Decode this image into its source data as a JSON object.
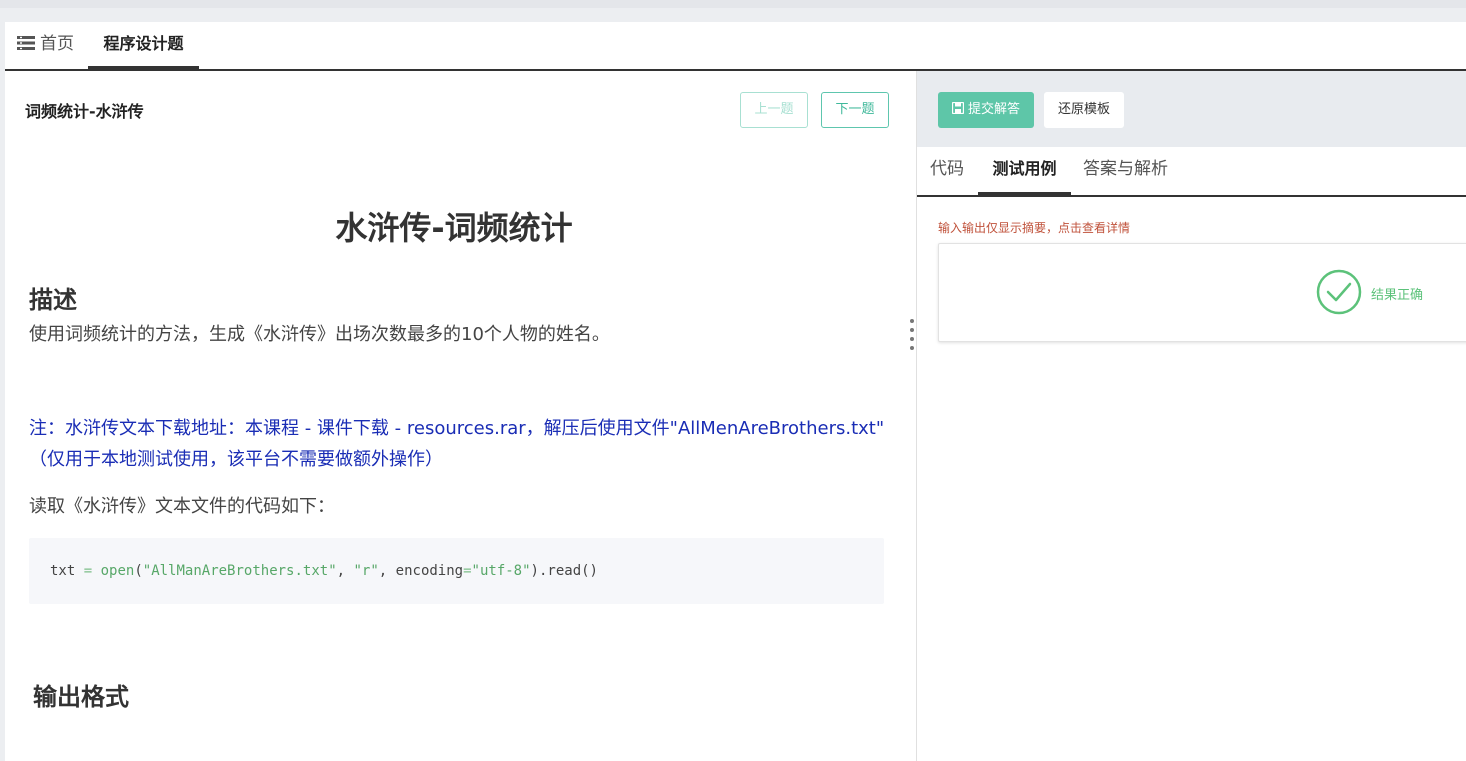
{
  "tabs": {
    "home": "首页",
    "program": "程序设计题"
  },
  "question": {
    "title": "词频统计-水浒传",
    "prev_label": "上一题",
    "next_label": "下一题",
    "heading": "水浒传-词频统计",
    "desc_heading": "描述",
    "desc_text": "使用词频统计的方法，生成《水浒传》出场次数最多的10个人物的姓名。",
    "note_line1": "注：水浒传文本下载地址：本课程 - 课件下载 - resources.rar，解压后使用文件\"AllMenAreBrothers.txt\"",
    "note_line2": "（仅用于本地测试使用，该平台不需要做额外操作）",
    "read_text": "读取《水浒传》文本文件的代码如下：",
    "code": {
      "var": "txt",
      "op": "=",
      "fn": "open",
      "arg1": "\"AllManAreBrothers.txt\"",
      "arg2": "\"r\"",
      "kw": "encoding",
      "kwval": "\"utf-8\"",
      "tail": ".read()"
    },
    "output_heading": "输出格式"
  },
  "right": {
    "submit_label": "提交解答",
    "restore_label": "还原模板",
    "tabs": {
      "code": "代码",
      "test": "测试用例",
      "answer": "答案与解析"
    },
    "hint": "输入输出仅显示摘要，点击查看详情",
    "result": "结果正确"
  },
  "colors": {
    "accent": "#5ec6a8",
    "success": "#5cc27a",
    "note": "#1a2db5",
    "hint": "#c0523b"
  }
}
